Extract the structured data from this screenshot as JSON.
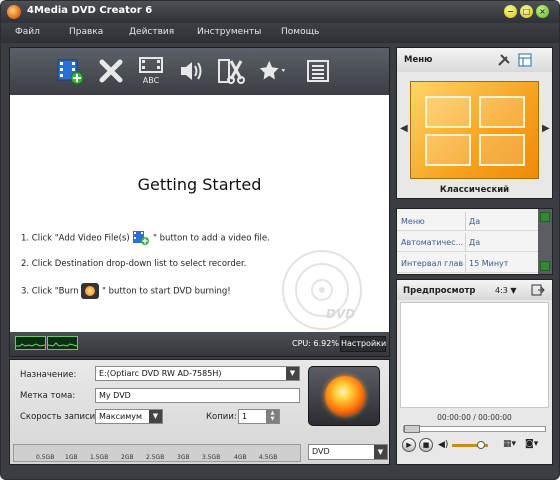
{
  "app": {
    "title": "4Media DVD Creator 6"
  },
  "window_buttons": {
    "minimize": "−",
    "maximize": "□",
    "close": "×"
  },
  "menu": [
    "Файл",
    "Правка",
    "Действия",
    "Инструменты",
    "Помощь"
  ],
  "toolbar": {
    "buttons": [
      "add-video-icon",
      "delete-icon",
      "subtitle-icon",
      "audio-icon",
      "cut-icon",
      "effect-icon",
      "list-icon"
    ],
    "subtitle_label": "ABC"
  },
  "getting_started": {
    "title": "Getting Started",
    "step1_a": "1. Click \"Add Video File(s)",
    "step1_b": "\" button to add a video file.",
    "step2": "2. Click Destination drop-down list to select recorder.",
    "step3_a": "3. Click \"Burn",
    "step3_b": "\" button to start DVD burning!",
    "watermark": "DVD"
  },
  "status": {
    "cpu": "CPU: 6.92%",
    "settings_label": "Настройки"
  },
  "output": {
    "destination_label": "Назначение:",
    "destination_value": "E:(Optiarc DVD RW AD-7585H)",
    "volume_label": "Метка тома:",
    "volume_value": "My DVD",
    "speed_label": "Скорость записи:",
    "speed_value": "Максимум",
    "copies_label": "Копии:",
    "copies_value": "1",
    "media_value": "DVD",
    "capacity_ticks": [
      "0.5GB",
      "1GB",
      "1.5GB",
      "2GB",
      "2.5GB",
      "3GB",
      "3.5GB",
      "4GB",
      "4.5GB"
    ]
  },
  "menu_panel": {
    "title": "Меню",
    "template_name": "Классический"
  },
  "properties": [
    {
      "key": "Меню",
      "value": "Да"
    },
    {
      "key": "Автоматичес...",
      "value": "Да"
    },
    {
      "key": "Интервал глав",
      "value": "15 Минут"
    }
  ],
  "preview": {
    "title": "Предпросмотр",
    "aspect": "4:3",
    "timecode": "00:00:00 / 00:00:00"
  },
  "colors": {
    "accent": "#f6a21e",
    "chrome": "#3a3d42",
    "meter": "#0c2f12"
  }
}
